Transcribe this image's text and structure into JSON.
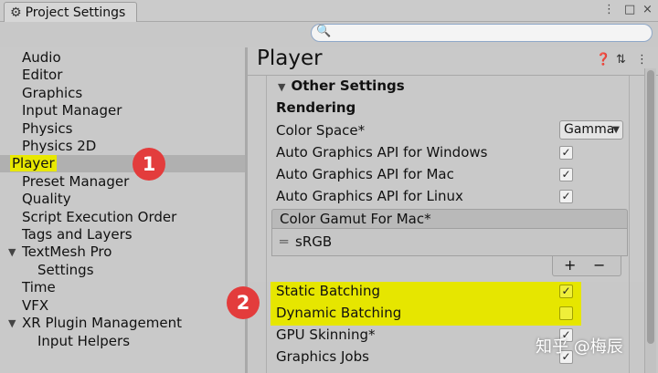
{
  "window": {
    "tab_title": "Project Settings",
    "controls": [
      "⋮",
      "□",
      "×"
    ]
  },
  "search": {
    "placeholder": "",
    "value": ""
  },
  "sidebar": {
    "items": [
      {
        "label": "Audio",
        "level": 1
      },
      {
        "label": "Editor",
        "level": 1
      },
      {
        "label": "Graphics",
        "level": 1
      },
      {
        "label": "Input Manager",
        "level": 1
      },
      {
        "label": "Physics",
        "level": 1
      },
      {
        "label": "Physics 2D",
        "level": 1
      },
      {
        "label": "Player",
        "level": 1,
        "selected": true,
        "highlighted": true
      },
      {
        "label": "Preset Manager",
        "level": 1
      },
      {
        "label": "Quality",
        "level": 1
      },
      {
        "label": "Script Execution Order",
        "level": 1
      },
      {
        "label": "Tags and Layers",
        "level": 1
      },
      {
        "label": "TextMesh Pro",
        "level": 1,
        "expanded": true
      },
      {
        "label": "Settings",
        "level": 2
      },
      {
        "label": "Time",
        "level": 1
      },
      {
        "label": "VFX",
        "level": 1
      },
      {
        "label": "XR Plugin Management",
        "level": 1,
        "expanded": true
      },
      {
        "label": "Input Helpers",
        "level": 2
      }
    ]
  },
  "main": {
    "title": "Player",
    "header_icons": [
      "help-icon",
      "preset-icon",
      "more-icon"
    ],
    "section": "Other Settings",
    "subsection": "Rendering",
    "color_space": {
      "label": "Color Space*",
      "value": "Gamma"
    },
    "rows": [
      {
        "label": "Auto Graphics API  for Windows",
        "checked": true
      },
      {
        "label": "Auto Graphics API  for Mac",
        "checked": true
      },
      {
        "label": "Auto Graphics API  for Linux",
        "checked": true
      }
    ],
    "color_gamut": {
      "header": "Color Gamut For Mac*",
      "items": [
        "sRGB"
      ],
      "add": "+",
      "remove": "−"
    },
    "batching_rows": [
      {
        "label": "Static Batching",
        "checked": true,
        "highlighted": true
      },
      {
        "label": "Dynamic Batching",
        "checked": false,
        "highlighted": true
      },
      {
        "label": "GPU Skinning*",
        "checked": true
      },
      {
        "label": "Graphics Jobs",
        "checked": true
      }
    ]
  },
  "annotations": {
    "badge_1": "1",
    "badge_2": "2",
    "highlight_color": "#e6e600"
  },
  "watermark": "知乎 @梅辰"
}
